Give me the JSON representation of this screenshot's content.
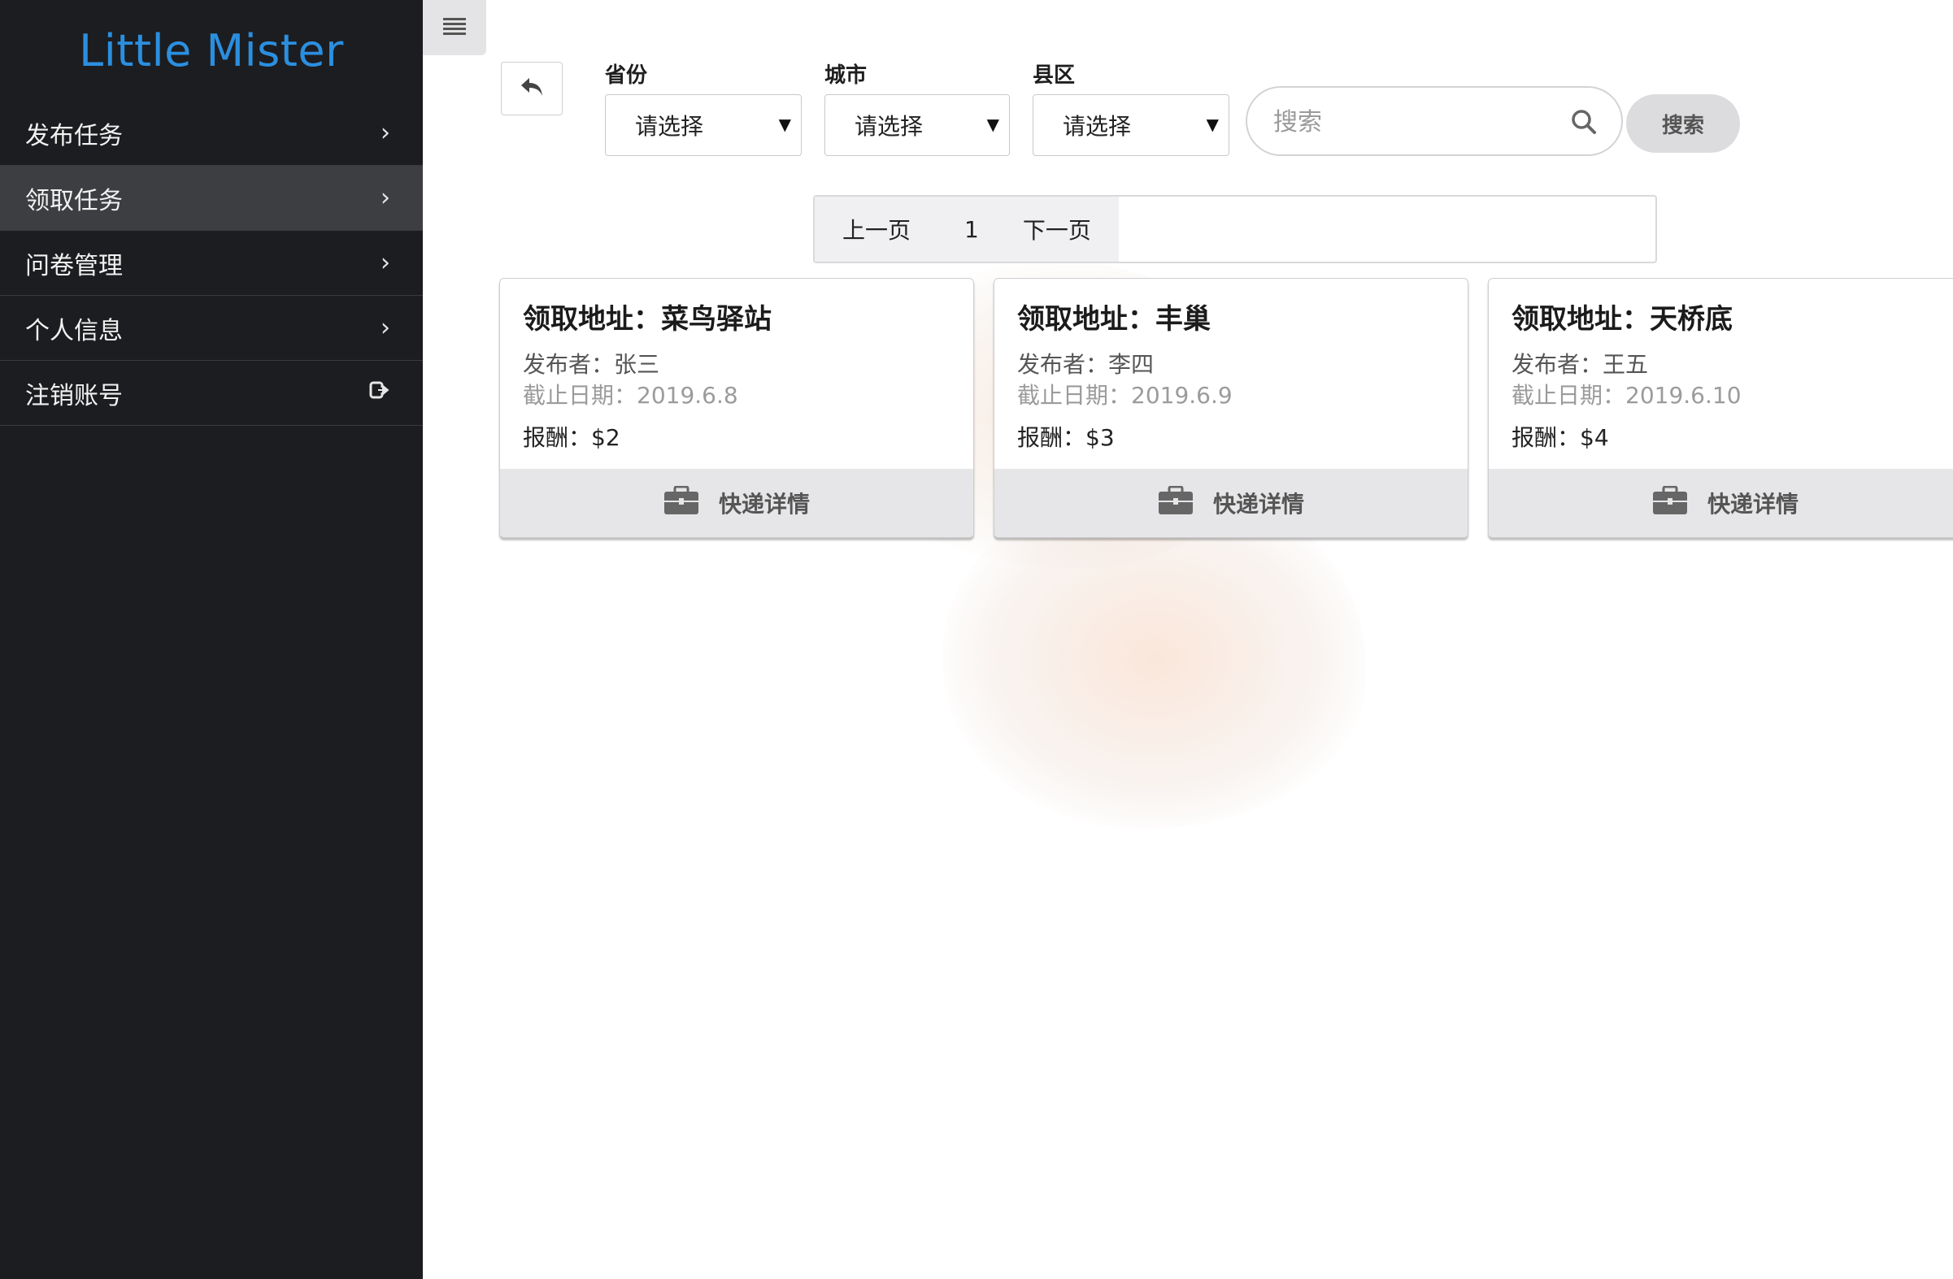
{
  "sidebar": {
    "brand": "Little Mister",
    "items": [
      {
        "label": "发布任务",
        "icon": "chevron-right-icon"
      },
      {
        "label": "领取任务",
        "icon": "chevron-right-icon",
        "active": true
      },
      {
        "label": "问卷管理",
        "icon": "chevron-right-icon"
      },
      {
        "label": "个人信息",
        "icon": "chevron-right-icon"
      },
      {
        "label": "注销账号",
        "icon": "sign-out-icon"
      }
    ]
  },
  "filters": {
    "province": {
      "label": "省份",
      "value": "请选择"
    },
    "city": {
      "label": "城市",
      "value": "请选择"
    },
    "district": {
      "label": "县区",
      "value": "请选择"
    }
  },
  "search": {
    "placeholder": "搜索",
    "button_label": "搜索"
  },
  "pagination": {
    "prev": "上一页",
    "current": "1",
    "next": "下一页"
  },
  "cards": [
    {
      "title": "领取地址：菜鸟驿站",
      "publisher": "发布者：张三",
      "deadline": "截止日期：2019.6.8",
      "reward": "报酬：$2",
      "action": "快递详情"
    },
    {
      "title": "领取地址：丰巢",
      "publisher": "发布者：李四",
      "deadline": "截止日期：2019.6.9",
      "reward": "报酬：$3",
      "action": "快递详情"
    },
    {
      "title": "领取地址：天桥底",
      "publisher": "发布者：王五",
      "deadline": "截止日期：2019.6.10",
      "reward": "报酬：$4",
      "action": "快递详情"
    }
  ],
  "colors": {
    "sidebar_bg": "#1c1d20",
    "sidebar_active": "#3d3e42",
    "brand": "#2b8fe0",
    "card_footer": "#e6e6e8"
  }
}
